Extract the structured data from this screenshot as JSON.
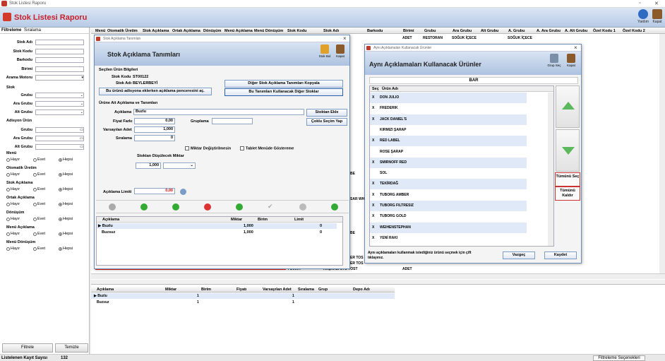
{
  "window": {
    "title": "Stok Listesi Raporu",
    "app_title": "Stok Listesi Raporu",
    "help": "Yardım",
    "close": "Kapat"
  },
  "left": {
    "tabs": [
      "Filtreleme",
      "Sıralama"
    ],
    "fields": [
      "Stok Adı",
      "Stok Kodu",
      "Barkodu",
      "Birimi",
      "Arama Motoru"
    ],
    "stok_section": "Stok",
    "stok_fields": [
      "Grubu",
      "Ara Grubu",
      "Alt Grubu"
    ],
    "adisyon_section": "Adisyon Ürün",
    "adisyon_fields": [
      "Grubu",
      "Ara Grubu",
      "Alt Grubu"
    ],
    "radio_groups": [
      {
        "title": "Menü",
        "selected": 2
      },
      {
        "title": "Otomatik Üretim",
        "selected": 2
      },
      {
        "title": "Stok Açıklama",
        "selected": 2
      },
      {
        "title": "Ortak Açıklama",
        "selected": 2
      },
      {
        "title": "Dönüşüm",
        "selected": 2
      },
      {
        "title": "Menü Açıklama",
        "selected": 2
      },
      {
        "title": "Menü Dönüşüm",
        "selected": 2
      }
    ],
    "radio_opts": [
      "Hayır",
      "Evet",
      "Hepsi"
    ],
    "filter_btn": "Filtrele",
    "clear_btn": "Temizle"
  },
  "grid": {
    "headers": [
      "Menü",
      "Otomatik Üretim",
      "Stok Açıklama",
      "Ortak Açıklama",
      "Dönüşüm",
      "Menü Açıklama",
      "Menü Dönüşüm",
      "Stok Kodu",
      "Stok Adı",
      "Barkodu",
      "Birimi",
      "Grubu",
      "Ara Grubu",
      "Alt Grubu",
      "A. Grubu",
      "A. Ara Grubu",
      "A. Alt Grubu",
      "Özel Kodu 1",
      "Özel Kodu 2"
    ],
    "row1": [
      "ADET",
      "RESTORAN",
      "SOĞUK İÇECE",
      "",
      "SOĞUK İÇECE"
    ],
    "visible_cells": [
      "BE",
      "SAR WH",
      "BE",
      "ER TOS",
      "ER TOS"
    ],
    "last_row": [
      "FD0004",
      "KAŞARLI UTU TOST",
      "ADET"
    ]
  },
  "bottom_grid": {
    "headers": [
      "Açıklama",
      "Miktar",
      "Birim",
      "Fiyatı",
      "Varsayılan Adet",
      "Sıralama",
      "Grup",
      "Depo Adı"
    ],
    "rows": [
      {
        "ac": "Buzlu",
        "mik": "1",
        "va": "1"
      },
      {
        "ac": "Buzsuz",
        "mik": "1",
        "va": "1"
      }
    ]
  },
  "status": {
    "label": "Listelenen Kayıt Sayısı",
    "count": "132",
    "filter_settings": "Filtreleme Seçenekleri"
  },
  "dlg1": {
    "titlebar": "Stok Açıklama Tanımları",
    "title": "Stok Açıklama Tanımları",
    "tb_stok_bul": "Stok Bul",
    "tb_kapat": "Kapat",
    "sec_selected": "Seçilen Ürün Bilgileri",
    "stok_kodu_label": "Stok Kodu",
    "stok_kodu": "ST00122",
    "stok_adi_label": "Stok Adı",
    "stok_adi": "BEYLERBEYİ",
    "btn_window": "Bu ürünü adisyona eklerken açıklama penceresini aç.",
    "btn_copy": "Diğer Stok Açıklama Tanımları Kopyala",
    "btn_other": "Bu Tanımları Kullanacak Diğer Stoklar",
    "sec_desc": "Ürüne Ait Açıklama ve Tanımları",
    "aciklama_label": "Açıklama",
    "aciklama": "Buzlu",
    "btn_stoktan_ekle": "Stoktan Ekle",
    "btn_coklu": "Çoklu Seçim Yap",
    "fiyat_label": "Fiyat Farkı",
    "fiyat": "0,00",
    "gruplama_label": "Gruplama",
    "varsayilan_label": "Varsayılan Adet",
    "varsayilan": "1,000",
    "siralama_label": "Sıralama",
    "siralama": "0",
    "chk_miktar": "Miktar Değiştirilmesin",
    "chk_tablet": "Tablet Menüde Göstereme",
    "stoktan_dus": "Stoktan Düşülecek Miktar",
    "dus_value": "1,000",
    "limit_label": "Açıklama Limiti",
    "limit": "0,00",
    "table_headers": [
      "Açıklama",
      "Miktar",
      "Birim",
      "Limit"
    ],
    "rows": [
      {
        "ac": "Buzlu",
        "mik": "1,000",
        "lim": "0"
      },
      {
        "ac": "Buzsuz",
        "mik": "1,000",
        "lim": "0"
      }
    ]
  },
  "dlg2": {
    "titlebar": "Aynı Açıklamaları Kullanacak Ürünler",
    "title": "Aynı Açıklamaları Kullanacak Ürünler",
    "tb_grup": "Grup Seç",
    "tb_kapat": "Kapat",
    "bar": "BAR",
    "headers": [
      "Seç",
      "Ürün Adı"
    ],
    "items": [
      {
        "x": "X",
        "n": "DON JULIO"
      },
      {
        "x": "X",
        "n": "FREDERIK"
      },
      {
        "x": "X",
        "n": "JACK DANIEL'S"
      },
      {
        "x": "",
        "n": "KIRMIZI ŞARAP"
      },
      {
        "x": "X",
        "n": "RED LABEL"
      },
      {
        "x": "",
        "n": "ROSE ŞARAP"
      },
      {
        "x": "X",
        "n": "SMIRNOFF RED"
      },
      {
        "x": "",
        "n": "SOL"
      },
      {
        "x": "X",
        "n": "TEKİRDAĞ"
      },
      {
        "x": "X",
        "n": "TUBORG AMBER"
      },
      {
        "x": "X",
        "n": "TUBORG FILTRESIZ"
      },
      {
        "x": "X",
        "n": "TUBORG GOLD"
      },
      {
        "x": "X",
        "n": "WEIHENSTEPHAN"
      },
      {
        "x": "X",
        "n": "YENİ RAKI"
      }
    ],
    "select_all": "Tümünü Seç",
    "clear_all": "Tümünü Kaldır",
    "info": "Aynı açıklamaları kullanmak istediğiniz ürünü seçmek için çift tıklayınız.",
    "cancel": "Vazgeç",
    "save": "Kaydet"
  }
}
